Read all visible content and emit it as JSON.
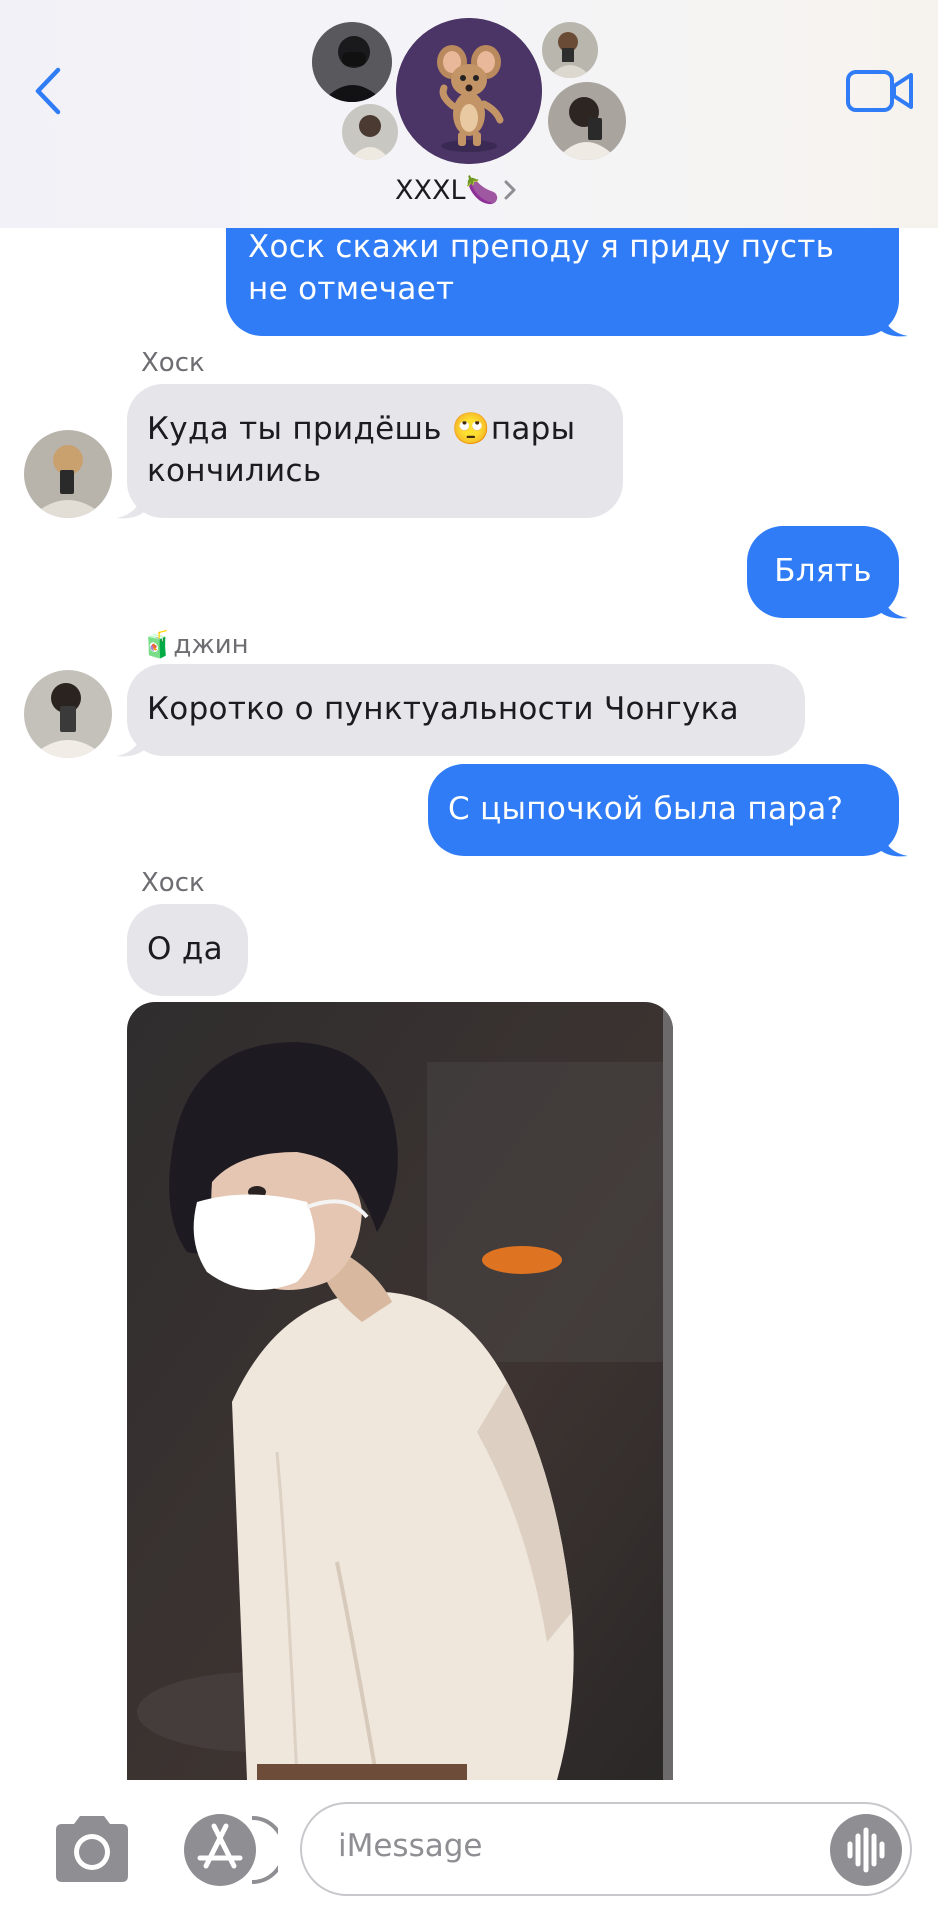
{
  "header": {
    "group_name": "XXXL🍆",
    "back_icon": "chevron-left-icon",
    "video_icon": "video-camera-icon",
    "accent_color": "#2f7cf6"
  },
  "messages": [
    {
      "side": "outgoing",
      "lines": [
        "Хоск скажи преподу я приду пусть",
        "не отмечает"
      ]
    },
    {
      "side": "incoming",
      "sender": "Хоск",
      "lines": [
        "Куда ты придёшь 🙄пары",
        "кончились"
      ]
    },
    {
      "side": "outgoing",
      "lines": [
        "Блять"
      ]
    },
    {
      "side": "incoming",
      "sender": "🧃джин",
      "lines": [
        "Коротко о пунктуальности Чонгука"
      ]
    },
    {
      "side": "outgoing",
      "lines": [
        "С цыпочкой была пара?"
      ]
    },
    {
      "side": "incoming",
      "sender": "Хоск",
      "lines": [
        "О да"
      ]
    },
    {
      "side": "incoming",
      "type": "photo"
    }
  ],
  "composer": {
    "placeholder": "iMessage",
    "camera_icon": "camera-icon",
    "apps_icon": "app-store-icon",
    "audio_icon": "audio-waveform-icon"
  }
}
